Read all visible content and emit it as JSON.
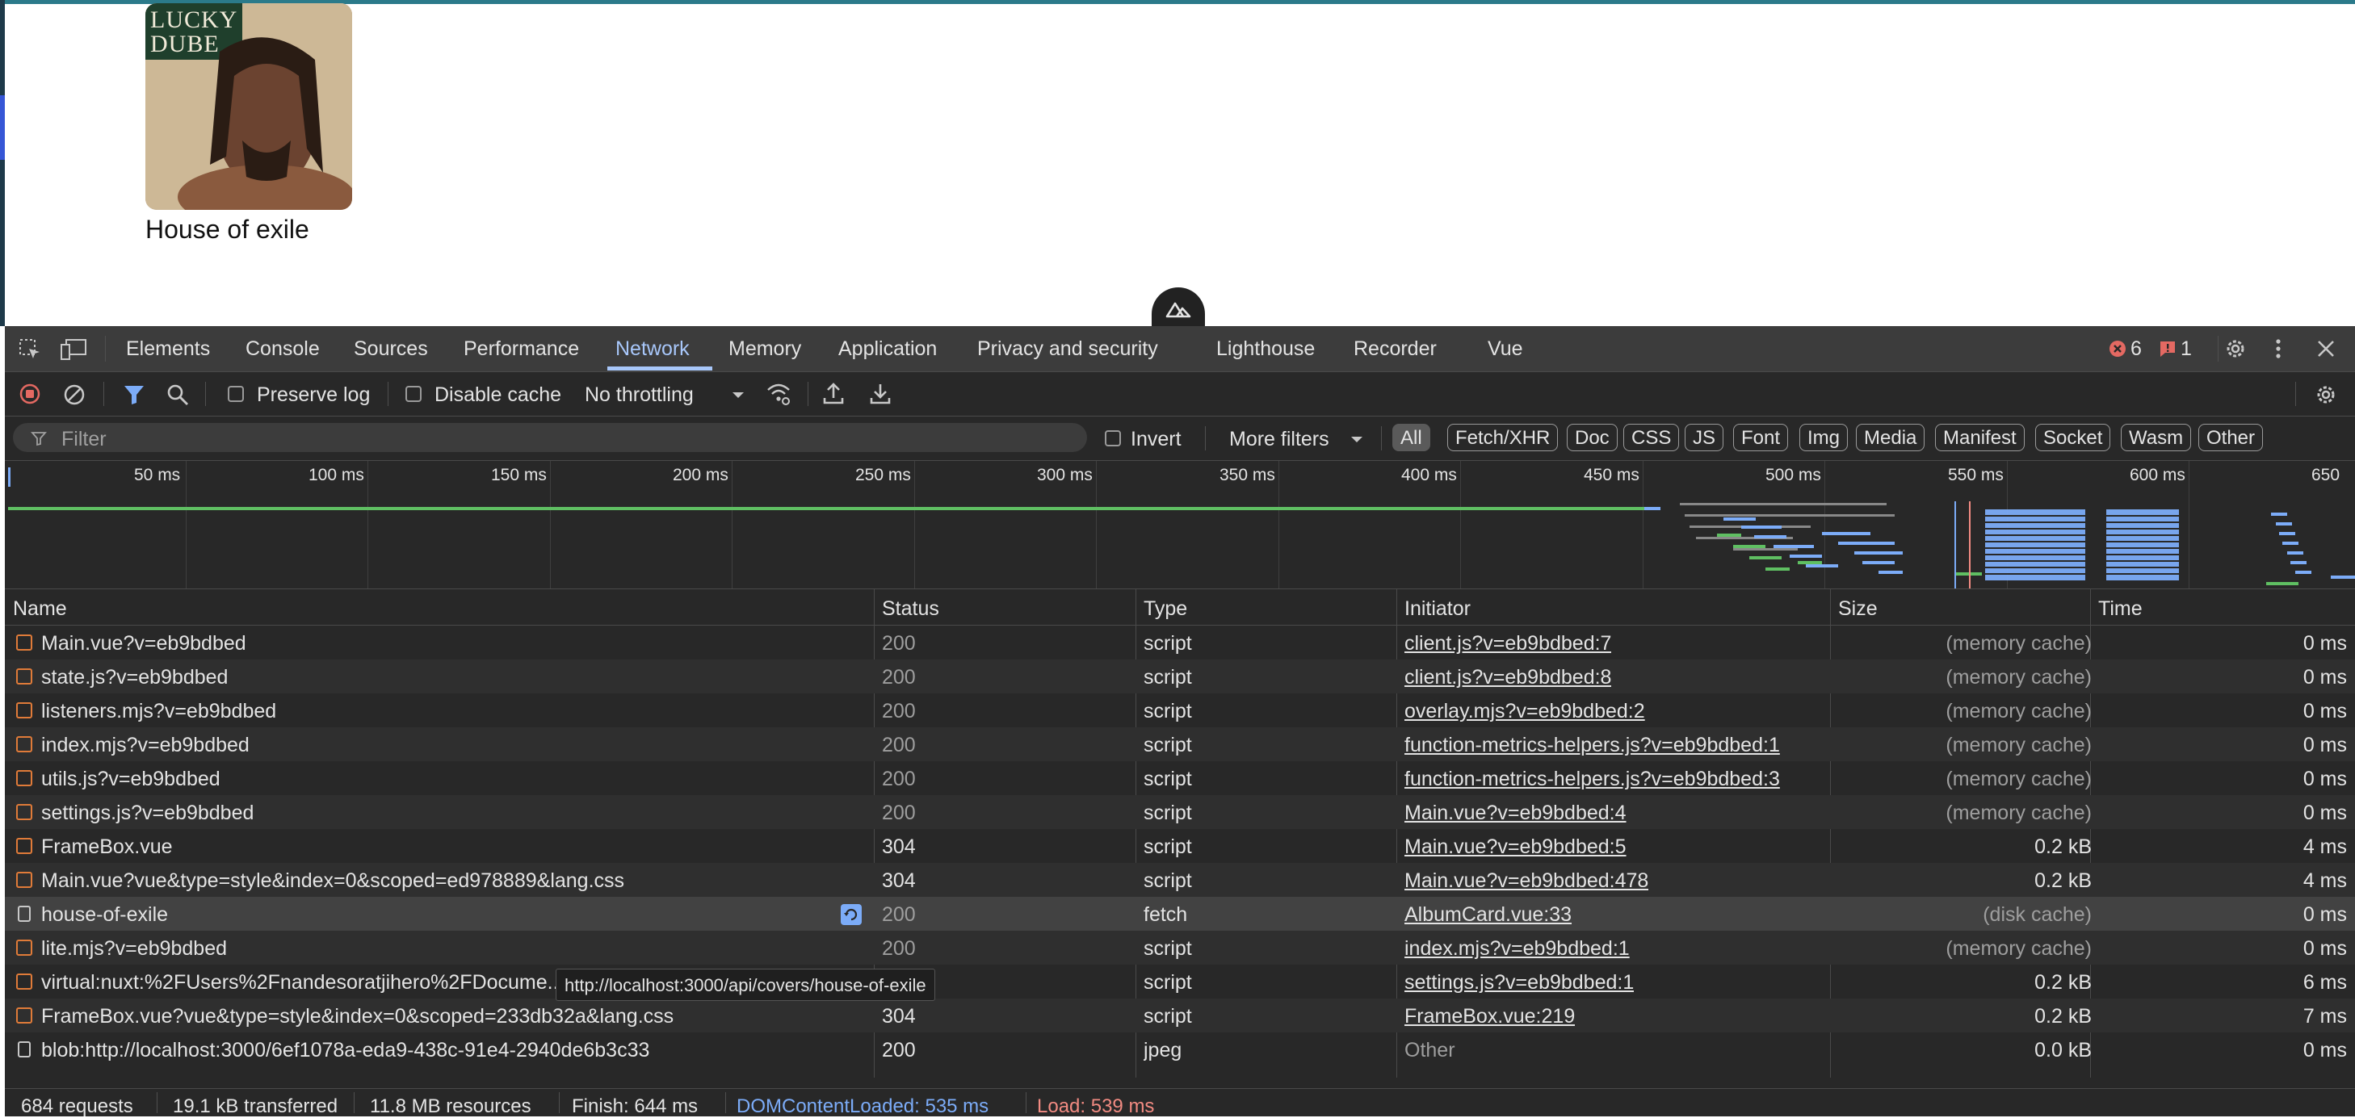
{
  "page": {
    "album_cover_text_line1": "LUCKY",
    "album_cover_text_line2": "DUBE",
    "album_caption": "House of exile"
  },
  "devtools": {
    "tabs": [
      {
        "label": "Elements"
      },
      {
        "label": "Console"
      },
      {
        "label": "Sources"
      },
      {
        "label": "Performance"
      },
      {
        "label": "Network",
        "active": true
      },
      {
        "label": "Memory"
      },
      {
        "label": "Application"
      },
      {
        "label": "Privacy and security"
      },
      {
        "label": "Lighthouse"
      },
      {
        "label": "Recorder"
      },
      {
        "label": "Vue"
      }
    ],
    "error_count": "6",
    "issue_count": "1",
    "toolbar": {
      "preserve_log": "Preserve log",
      "disable_cache": "Disable cache",
      "throttling": "No throttling"
    },
    "filter": {
      "placeholder": "Filter",
      "invert": "Invert",
      "more_filters": "More filters",
      "type_filters": [
        "All",
        "Fetch/XHR",
        "Doc",
        "CSS",
        "JS",
        "Font",
        "Img",
        "Media",
        "Manifest",
        "Socket",
        "Wasm",
        "Other"
      ]
    },
    "overview_ticks": [
      "50 ms",
      "100 ms",
      "150 ms",
      "200 ms",
      "250 ms",
      "300 ms",
      "350 ms",
      "400 ms",
      "450 ms",
      "500 ms",
      "550 ms",
      "600 ms",
      "650"
    ],
    "columns": [
      "Name",
      "Status",
      "Type",
      "Initiator",
      "Size",
      "Time"
    ],
    "rows": [
      {
        "name": "Main.vue?v=eb9bdbed",
        "status": "200",
        "type": "script",
        "initiator": "client.js?v=eb9bdbed:7",
        "size": "(memory cache)",
        "time": "0 ms",
        "kind": "script"
      },
      {
        "name": "state.js?v=eb9bdbed",
        "status": "200",
        "type": "script",
        "initiator": "client.js?v=eb9bdbed:8",
        "size": "(memory cache)",
        "time": "0 ms",
        "kind": "script"
      },
      {
        "name": "listeners.mjs?v=eb9bdbed",
        "status": "200",
        "type": "script",
        "initiator": "overlay.mjs?v=eb9bdbed:2",
        "size": "(memory cache)",
        "time": "0 ms",
        "kind": "script"
      },
      {
        "name": "index.mjs?v=eb9bdbed",
        "status": "200",
        "type": "script",
        "initiator": "function-metrics-helpers.js?v=eb9bdbed:1",
        "size": "(memory cache)",
        "time": "0 ms",
        "kind": "script"
      },
      {
        "name": "utils.js?v=eb9bdbed",
        "status": "200",
        "type": "script",
        "initiator": "function-metrics-helpers.js?v=eb9bdbed:3",
        "size": "(memory cache)",
        "time": "0 ms",
        "kind": "script"
      },
      {
        "name": "settings.js?v=eb9bdbed",
        "status": "200",
        "type": "script",
        "initiator": "Main.vue?v=eb9bdbed:4",
        "size": "(memory cache)",
        "time": "0 ms",
        "kind": "script"
      },
      {
        "name": "FrameBox.vue",
        "status": "304",
        "type": "script",
        "initiator": "Main.vue?v=eb9bdbed:5",
        "size": "0.2 kB",
        "time": "4 ms",
        "kind": "script"
      },
      {
        "name": "Main.vue?vue&type=style&index=0&scoped=ed978889&lang.css",
        "status": "304",
        "type": "script",
        "initiator": "Main.vue?v=eb9bdbed:478",
        "size": "0.2 kB",
        "time": "4 ms",
        "kind": "script"
      },
      {
        "name": "house-of-exile",
        "status": "200",
        "type": "fetch",
        "initiator": "AlbumCard.vue:33",
        "size": "(disk cache)",
        "time": "0 ms",
        "kind": "fetch"
      },
      {
        "name": "lite.mjs?v=eb9bdbed",
        "status": "200",
        "type": "script",
        "initiator": "index.mjs?v=eb9bdbed:1",
        "size": "(memory cache)",
        "time": "0 ms",
        "kind": "script"
      },
      {
        "name": "virtual:nuxt:%2FUsers%2Fnandesoratjihero%2FDocume...",
        "status": "304",
        "type": "script",
        "initiator": "settings.js?v=eb9bdbed:1",
        "size": "0.2 kB",
        "time": "6 ms",
        "kind": "script"
      },
      {
        "name": "FrameBox.vue?vue&type=style&index=0&scoped=233db32a&lang.css",
        "status": "304",
        "type": "script",
        "initiator": "FrameBox.vue:219",
        "size": "0.2 kB",
        "time": "7 ms",
        "kind": "script"
      },
      {
        "name": "blob:http://localhost:3000/6ef1078a-eda9-438c-91e4-2940de6b3c33",
        "status": "200",
        "type": "jpeg",
        "initiator": "Other",
        "size": "0.0 kB",
        "time": "0 ms",
        "kind": "img"
      }
    ],
    "tooltip": "http://localhost:3000/api/covers/house-of-exile",
    "status": {
      "requests": "684 requests",
      "transferred": "19.1 kB transferred",
      "resources": "11.8 MB resources",
      "finish": "Finish: 644 ms",
      "dom_content_loaded": "DOMContentLoaded: 535 ms",
      "load": "Load: 539 ms"
    },
    "colors": {
      "active_tab": "#a8c7fa",
      "dcl_blue": "#7cacf8",
      "load_red": "#f28b82",
      "record_red": "#e46962"
    }
  }
}
